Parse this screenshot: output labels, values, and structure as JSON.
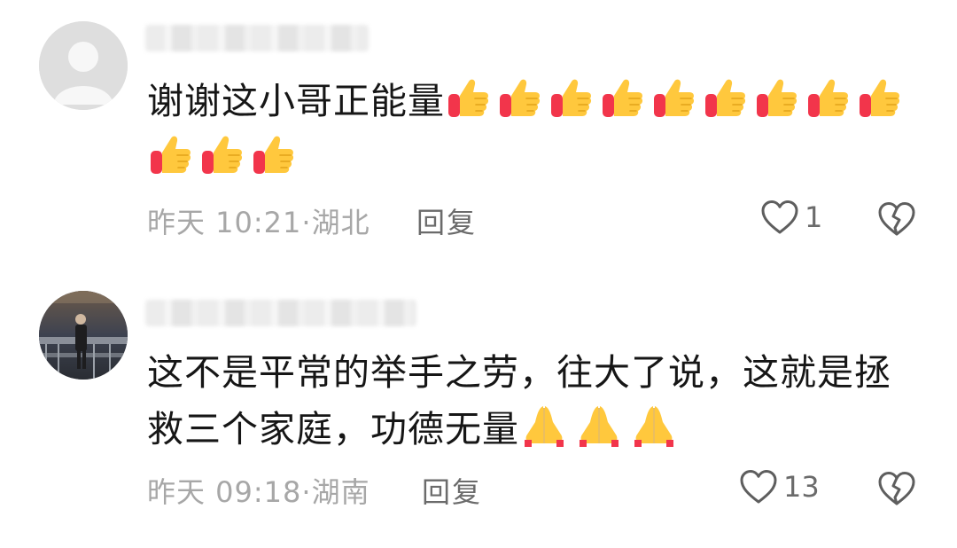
{
  "comments": [
    {
      "text": "谢谢这小哥正能量",
      "emoji": "thumbs-up",
      "emoji_count": 12,
      "time": "昨天 10:21",
      "location": "湖北",
      "reply_label": "回复",
      "likes": "1"
    },
    {
      "text": "这不是平常的举手之劳，往大了说，这就是拯救三个家庭，功德无量",
      "emoji": "folded-hands",
      "emoji_count": 3,
      "time": "昨天 09:18",
      "location": "湖南",
      "reply_label": "回复",
      "likes": "13"
    }
  ],
  "meta_separator": "·",
  "colors": {
    "meta_text": "#a7a7a7",
    "action_text": "#6b6b6b",
    "body_text": "#161616",
    "emoji_yellow": "#ffc83d",
    "emoji_red": "#f2354b"
  }
}
